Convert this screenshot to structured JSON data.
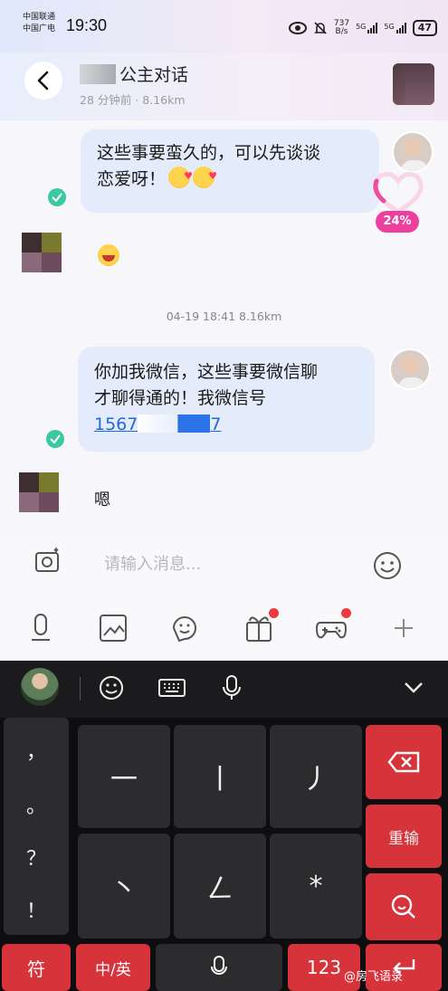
{
  "status_bar": {
    "carrier_1": "中国联通",
    "carrier_2": "中国广电",
    "time": "19:30",
    "net_speed_value": "737",
    "net_speed_unit": "B/s",
    "signal_1": "5G",
    "signal_2": "5G",
    "battery": "47",
    "icons": [
      "eye-icon",
      "mute-bell-icon",
      "signal-icon",
      "signal-icon",
      "battery-icon"
    ]
  },
  "header": {
    "title": "公主对话",
    "subtitle": "28 分钟前 · 8.16km"
  },
  "messages": [
    {
      "side": "right",
      "text_line1": "这些事要蛮久的，可以先谈谈",
      "text_line2": "恋爱呀！"
    },
    {
      "side": "left",
      "emoji": "laughing-face"
    },
    {
      "timestamp": "04-19 18:41  8.16km"
    },
    {
      "side": "right",
      "text_line1": "你加我微信，这些事要微信聊",
      "text_line2": "才聊得通的！我微信号",
      "phone_prefix": "1567",
      "phone_suffix": "7"
    },
    {
      "side": "left",
      "text": "嗯"
    }
  ],
  "intimacy": {
    "percent": "24%",
    "level": 0.24
  },
  "composer": {
    "placeholder": "请输入消息...",
    "tools": [
      "voice-icon",
      "image-icon",
      "sticker-icon",
      "gift-icon",
      "game-icon",
      "plus-icon"
    ]
  },
  "keyboard": {
    "top_icons": [
      "emoji-icon",
      "keyboard-icon",
      "mic-icon",
      "chevron-down-icon"
    ],
    "side_punct": [
      "，",
      "。",
      "？",
      "！"
    ],
    "stroke_keys": [
      "一",
      "丨",
      "丿",
      "丶",
      "ㄥ",
      "*"
    ],
    "delete_label": "delete",
    "reset_label": "重输",
    "search_label": "search",
    "bottom": {
      "symbols": "符",
      "lang": "中/英",
      "space_mic": "mic",
      "num": "123",
      "enter": "enter"
    }
  },
  "watermark": "@房飞语录"
}
